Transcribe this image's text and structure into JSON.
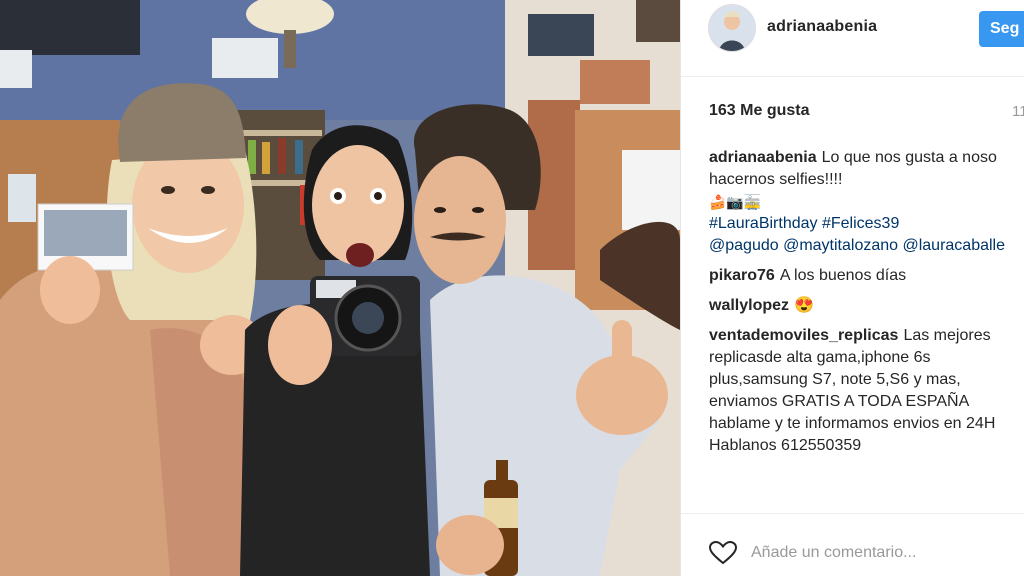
{
  "post": {
    "username": "adrianaabenia",
    "follow_label": "Seg",
    "likes": "163 Me gusta",
    "time": "11",
    "caption_user": "adrianaabenia",
    "caption_line1": "Lo que nos gusta a noso",
    "caption_line2": "hacernos selfies!!!!",
    "caption_emoji": "🍰📷🚋",
    "caption_tags": "#LauraBirthday #Felices39",
    "caption_mentions": "@pagudo @maytitalozano @lauracaballe",
    "comments": [
      {
        "user": "pikaro76",
        "text": "A los buenos días"
      },
      {
        "user": "wallylopez",
        "text": "😍"
      },
      {
        "user": "ventademoviles_replicas",
        "text": "Las mejores"
      }
    ],
    "spam_lines": [
      "replicasde alta gama,iphone 6s",
      "plus,samsung S7, note 5,S6 y mas,",
      "enviamos GRATIS A TODA ESPAÑA",
      "hablame y te informamos envios en 24H",
      "Hablanos 612550359"
    ],
    "add_comment_placeholder": "Añade un comentario..."
  },
  "icons": {
    "heart": "heart-icon",
    "avatar": "avatar"
  },
  "colors": {
    "follow": "#3897f0",
    "tag": "#003569",
    "text": "#262626",
    "muted": "#999999"
  }
}
